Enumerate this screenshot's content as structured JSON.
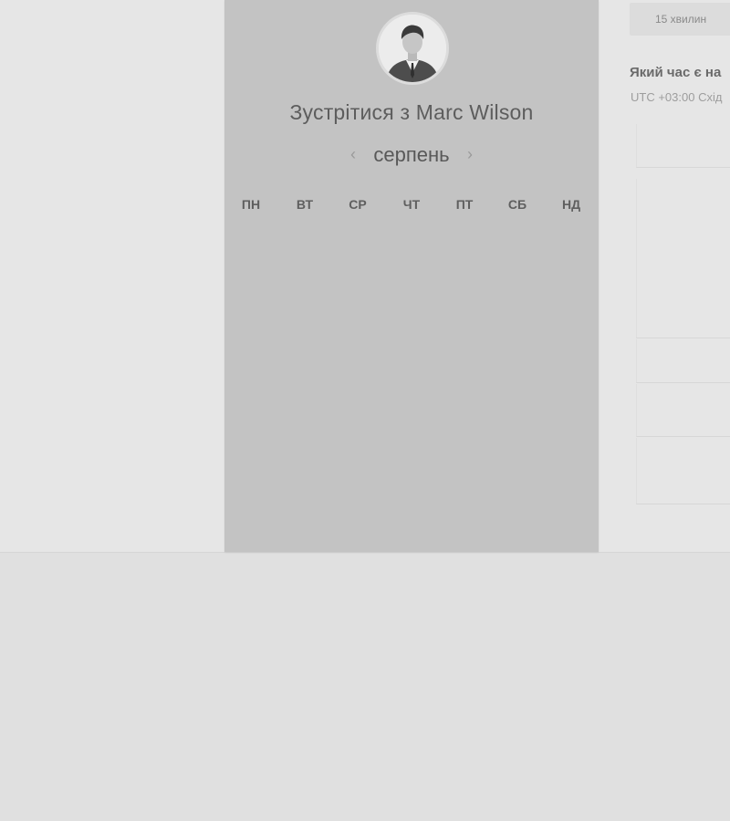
{
  "host": {
    "title": "Зустрітися з Marc Wilson",
    "avatar_icon": "person-photo-icon"
  },
  "calendar": {
    "month": "серпень",
    "prev_icon": "chevron-left-icon",
    "next_icon": "chevron-right-icon",
    "weekdays": [
      "ПН",
      "ВТ",
      "СР",
      "ЧТ",
      "ПТ",
      "СБ",
      "НД"
    ]
  },
  "duration": {
    "label": "15 хвилин"
  },
  "timezone": {
    "question": "Який час є на",
    "value": "UTC +03:00 Схід"
  },
  "colors": {
    "card_background": "#c3c3c3",
    "page_background": "#e6e6e6",
    "title_text": "#5d5d5d"
  }
}
